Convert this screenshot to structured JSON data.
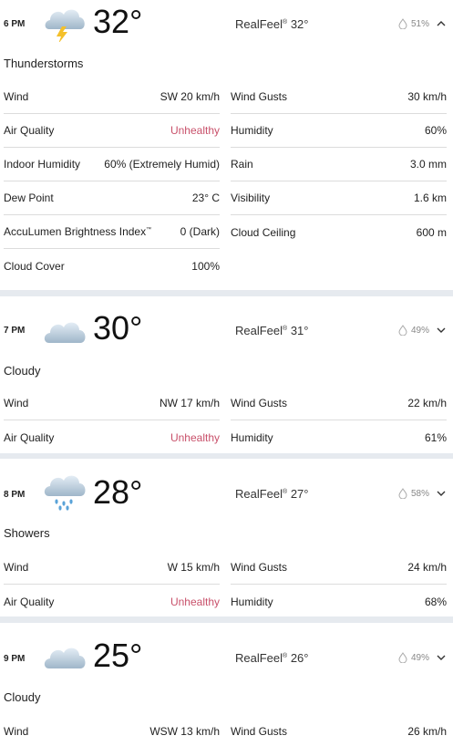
{
  "hours": [
    {
      "time": "6 PM",
      "temp": "32°",
      "realfeel_label": "RealFeel",
      "realfeel_value": "32°",
      "precip": "51%",
      "condition": "Thunderstorms",
      "expanded": true,
      "icon": "thunderstorm-icon",
      "left": [
        {
          "label": "Wind",
          "value": "SW 20 km/h"
        },
        {
          "label": "Air Quality",
          "value": "Unhealthy"
        },
        {
          "label": "Indoor Humidity",
          "value": "60% (Extremely Humid)"
        },
        {
          "label": "Dew Point",
          "value": "23° C"
        },
        {
          "label": "AccuLumen Brightness Index",
          "label_mark": "™",
          "value": "0 (Dark)"
        },
        {
          "label": "Cloud Cover",
          "value": "100%"
        }
      ],
      "right": [
        {
          "label": "Wind Gusts",
          "value": "30 km/h"
        },
        {
          "label": "Humidity",
          "value": "60%"
        },
        {
          "label": "Rain",
          "value": "3.0 mm"
        },
        {
          "label": "Visibility",
          "value": "1.6 km"
        },
        {
          "label": "Cloud Ceiling",
          "value": "600 m"
        }
      ]
    },
    {
      "time": "7 PM",
      "temp": "30°",
      "realfeel_label": "RealFeel",
      "realfeel_value": "31°",
      "precip": "49%",
      "condition": "Cloudy",
      "expanded": false,
      "icon": "cloud-icon",
      "left": [
        {
          "label": "Wind",
          "value": "NW 17 km/h"
        },
        {
          "label": "Air Quality",
          "value": "Unhealthy"
        }
      ],
      "right": [
        {
          "label": "Wind Gusts",
          "value": "22 km/h"
        },
        {
          "label": "Humidity",
          "value": "61%"
        }
      ]
    },
    {
      "time": "8 PM",
      "temp": "28°",
      "realfeel_label": "RealFeel",
      "realfeel_value": "27°",
      "precip": "58%",
      "condition": "Showers",
      "expanded": false,
      "icon": "showers-icon",
      "left": [
        {
          "label": "Wind",
          "value": "W 15 km/h"
        },
        {
          "label": "Air Quality",
          "value": "Unhealthy"
        }
      ],
      "right": [
        {
          "label": "Wind Gusts",
          "value": "24 km/h"
        },
        {
          "label": "Humidity",
          "value": "68%"
        }
      ]
    },
    {
      "time": "9 PM",
      "temp": "25°",
      "realfeel_label": "RealFeel",
      "realfeel_value": "26°",
      "precip": "49%",
      "condition": "Cloudy",
      "expanded": false,
      "icon": "cloud-icon",
      "left": [
        {
          "label": "Wind",
          "value": "WSW 13 km/h"
        }
      ],
      "right": [
        {
          "label": "Wind Gusts",
          "value": "26 km/h"
        }
      ]
    }
  ],
  "realfeel_mark": "®",
  "colors": {
    "unhealthy": "#c8506a",
    "divider": "#dcdcdc",
    "background": "#e6eaef"
  }
}
